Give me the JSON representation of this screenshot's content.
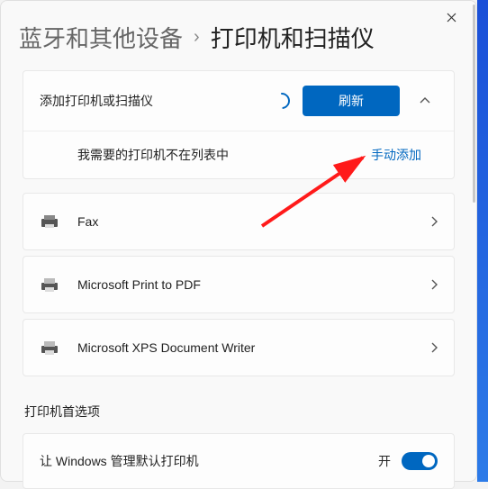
{
  "breadcrumb": {
    "parent": "蓝牙和其他设备",
    "separator": "›",
    "current": "打印机和扫描仪"
  },
  "add_section": {
    "label": "添加打印机或扫描仪",
    "refresh": "刷新",
    "not_listed": "我需要的打印机不在列表中",
    "manual_add": "手动添加"
  },
  "printers": [
    {
      "name": "Fax"
    },
    {
      "name": "Microsoft Print to PDF"
    },
    {
      "name": "Microsoft XPS Document Writer"
    }
  ],
  "prefs": {
    "heading": "打印机首选项",
    "default_toggle_label": "让 Windows 管理默认打印机",
    "default_toggle_state": "开"
  }
}
